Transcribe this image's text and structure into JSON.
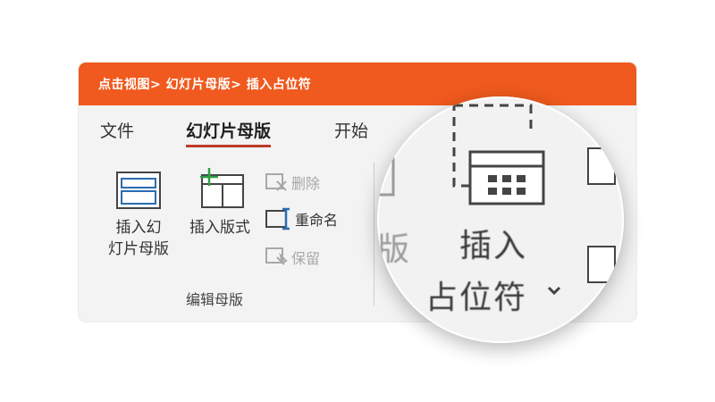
{
  "breadcrumb": "点击视图> 幻灯片母版> 插入占位符",
  "tabs": [
    {
      "label": "文件"
    },
    {
      "label": "幻灯片母版"
    },
    {
      "label": "开始"
    }
  ],
  "ribbon": {
    "insert_master": {
      "line1": "插入幻",
      "line2": "灯片母版"
    },
    "insert_layout": {
      "label": "插入版式"
    },
    "delete_label": "删除",
    "rename_label": "重命名",
    "preserve_label": "保留",
    "group_label": "编辑母版"
  },
  "magnifier": {
    "insert_line1": "插入",
    "insert_line2": "占位符",
    "behind_text": "版"
  },
  "colors": {
    "banner": "#f05a1e",
    "active_tab_underline": "#c0392b",
    "icon_blue": "#2b6cb0",
    "icon_green": "#2e9e44"
  }
}
